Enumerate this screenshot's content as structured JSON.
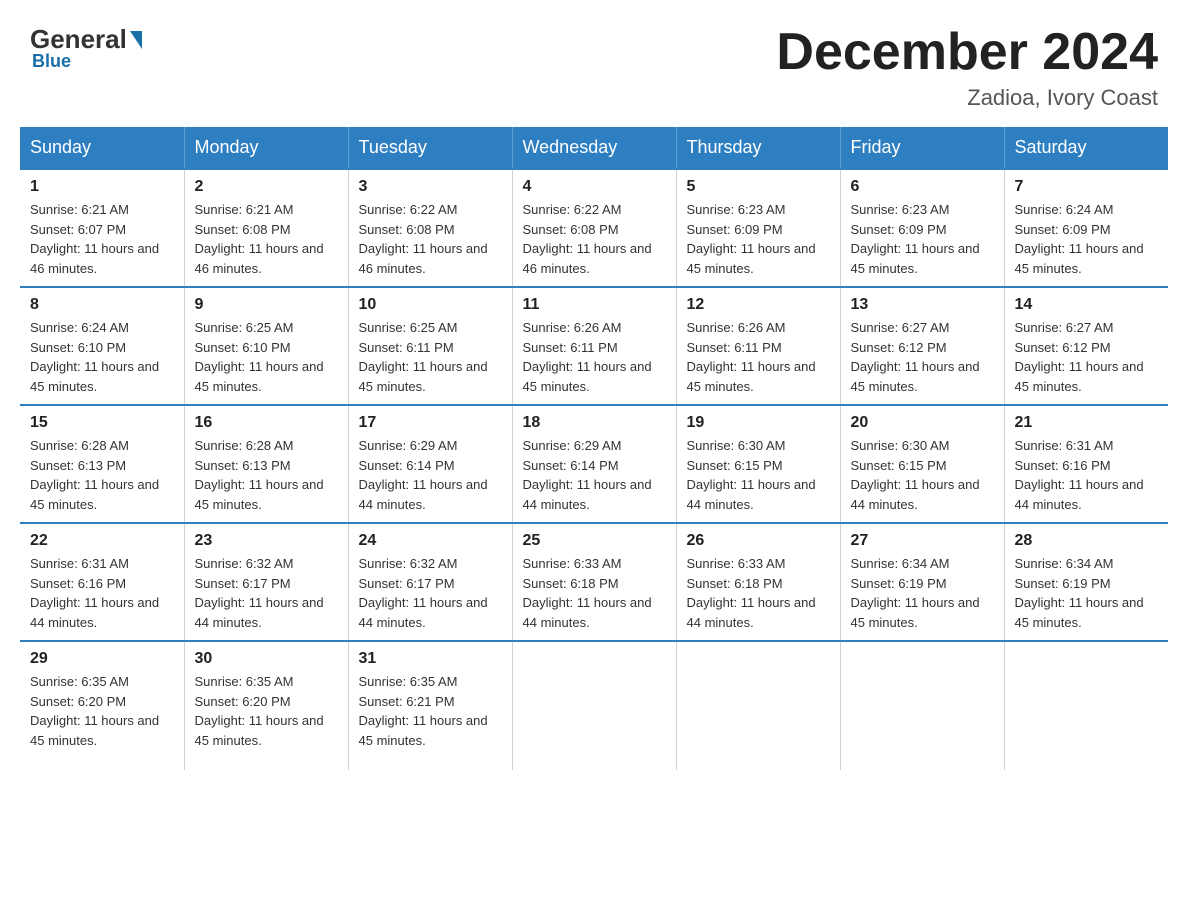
{
  "logo": {
    "general": "General",
    "blue": "Blue"
  },
  "header": {
    "month_year": "December 2024",
    "location": "Zadioa, Ivory Coast"
  },
  "weekdays": [
    "Sunday",
    "Monday",
    "Tuesday",
    "Wednesday",
    "Thursday",
    "Friday",
    "Saturday"
  ],
  "weeks": [
    [
      {
        "day": "1",
        "sunrise": "6:21 AM",
        "sunset": "6:07 PM",
        "daylight": "11 hours and 46 minutes."
      },
      {
        "day": "2",
        "sunrise": "6:21 AM",
        "sunset": "6:08 PM",
        "daylight": "11 hours and 46 minutes."
      },
      {
        "day": "3",
        "sunrise": "6:22 AM",
        "sunset": "6:08 PM",
        "daylight": "11 hours and 46 minutes."
      },
      {
        "day": "4",
        "sunrise": "6:22 AM",
        "sunset": "6:08 PM",
        "daylight": "11 hours and 46 minutes."
      },
      {
        "day": "5",
        "sunrise": "6:23 AM",
        "sunset": "6:09 PM",
        "daylight": "11 hours and 45 minutes."
      },
      {
        "day": "6",
        "sunrise": "6:23 AM",
        "sunset": "6:09 PM",
        "daylight": "11 hours and 45 minutes."
      },
      {
        "day": "7",
        "sunrise": "6:24 AM",
        "sunset": "6:09 PM",
        "daylight": "11 hours and 45 minutes."
      }
    ],
    [
      {
        "day": "8",
        "sunrise": "6:24 AM",
        "sunset": "6:10 PM",
        "daylight": "11 hours and 45 minutes."
      },
      {
        "day": "9",
        "sunrise": "6:25 AM",
        "sunset": "6:10 PM",
        "daylight": "11 hours and 45 minutes."
      },
      {
        "day": "10",
        "sunrise": "6:25 AM",
        "sunset": "6:11 PM",
        "daylight": "11 hours and 45 minutes."
      },
      {
        "day": "11",
        "sunrise": "6:26 AM",
        "sunset": "6:11 PM",
        "daylight": "11 hours and 45 minutes."
      },
      {
        "day": "12",
        "sunrise": "6:26 AM",
        "sunset": "6:11 PM",
        "daylight": "11 hours and 45 minutes."
      },
      {
        "day": "13",
        "sunrise": "6:27 AM",
        "sunset": "6:12 PM",
        "daylight": "11 hours and 45 minutes."
      },
      {
        "day": "14",
        "sunrise": "6:27 AM",
        "sunset": "6:12 PM",
        "daylight": "11 hours and 45 minutes."
      }
    ],
    [
      {
        "day": "15",
        "sunrise": "6:28 AM",
        "sunset": "6:13 PM",
        "daylight": "11 hours and 45 minutes."
      },
      {
        "day": "16",
        "sunrise": "6:28 AM",
        "sunset": "6:13 PM",
        "daylight": "11 hours and 45 minutes."
      },
      {
        "day": "17",
        "sunrise": "6:29 AM",
        "sunset": "6:14 PM",
        "daylight": "11 hours and 44 minutes."
      },
      {
        "day": "18",
        "sunrise": "6:29 AM",
        "sunset": "6:14 PM",
        "daylight": "11 hours and 44 minutes."
      },
      {
        "day": "19",
        "sunrise": "6:30 AM",
        "sunset": "6:15 PM",
        "daylight": "11 hours and 44 minutes."
      },
      {
        "day": "20",
        "sunrise": "6:30 AM",
        "sunset": "6:15 PM",
        "daylight": "11 hours and 44 minutes."
      },
      {
        "day": "21",
        "sunrise": "6:31 AM",
        "sunset": "6:16 PM",
        "daylight": "11 hours and 44 minutes."
      }
    ],
    [
      {
        "day": "22",
        "sunrise": "6:31 AM",
        "sunset": "6:16 PM",
        "daylight": "11 hours and 44 minutes."
      },
      {
        "day": "23",
        "sunrise": "6:32 AM",
        "sunset": "6:17 PM",
        "daylight": "11 hours and 44 minutes."
      },
      {
        "day": "24",
        "sunrise": "6:32 AM",
        "sunset": "6:17 PM",
        "daylight": "11 hours and 44 minutes."
      },
      {
        "day": "25",
        "sunrise": "6:33 AM",
        "sunset": "6:18 PM",
        "daylight": "11 hours and 44 minutes."
      },
      {
        "day": "26",
        "sunrise": "6:33 AM",
        "sunset": "6:18 PM",
        "daylight": "11 hours and 44 minutes."
      },
      {
        "day": "27",
        "sunrise": "6:34 AM",
        "sunset": "6:19 PM",
        "daylight": "11 hours and 45 minutes."
      },
      {
        "day": "28",
        "sunrise": "6:34 AM",
        "sunset": "6:19 PM",
        "daylight": "11 hours and 45 minutes."
      }
    ],
    [
      {
        "day": "29",
        "sunrise": "6:35 AM",
        "sunset": "6:20 PM",
        "daylight": "11 hours and 45 minutes."
      },
      {
        "day": "30",
        "sunrise": "6:35 AM",
        "sunset": "6:20 PM",
        "daylight": "11 hours and 45 minutes."
      },
      {
        "day": "31",
        "sunrise": "6:35 AM",
        "sunset": "6:21 PM",
        "daylight": "11 hours and 45 minutes."
      },
      null,
      null,
      null,
      null
    ]
  ]
}
